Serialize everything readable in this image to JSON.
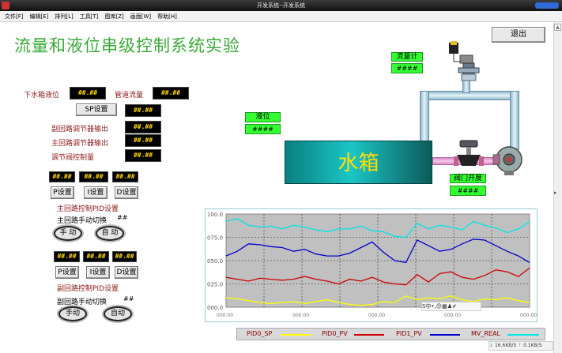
{
  "window": {
    "title": "开发系统--开发系统"
  },
  "menu": [
    "文件[F]",
    "编辑[E]",
    "排列[L]",
    "工具[T]",
    "图库[Z]",
    "画面[W]",
    "帮助[H]"
  ],
  "main_title": "流量和液位串级控制系统实验",
  "exit_button": "退出",
  "top_labels": {
    "lower_tank_level": "下水箱液位",
    "pipe_flow": "管道流量"
  },
  "placeholder_value": "##.##",
  "hash_value": "####",
  "double_hash": "##",
  "sp_button": "SP设置",
  "outputs": {
    "secondary_out": "副回路调节器输出",
    "primary_out": "主回路调节器输出",
    "valve_amount": "调节阀控制量"
  },
  "pid_buttons": {
    "p": "P设置",
    "i": "I设置",
    "d": "D设置"
  },
  "primary_pid_label": "主回路控制PID设置",
  "primary_switch_label": "主回路手动切换",
  "secondary_pid_label": "副回路控制PID设置",
  "secondary_switch_label": "副回路手动切换",
  "mode_buttons": {
    "manual": "手 动",
    "auto": "自 动",
    "manual2": "手动",
    "auto2": "自动"
  },
  "process": {
    "flowmeter_label": "流量计",
    "level_label": "液位",
    "tank_label": "水箱",
    "valve_label": "阀门开度"
  },
  "colors": {
    "title_green": "#3aa83a",
    "display_yellow": "#ffd700",
    "label_green": "#33ff33",
    "sp_series": "#ffff00",
    "pv0_series": "#cc0000",
    "pv1_series": "#0000cc",
    "mv_series": "#00e5e5"
  },
  "chart_data": {
    "type": "line",
    "yticks": [
      "100.0",
      "075.0",
      "050.0",
      "025.0",
      "000.0"
    ],
    "xticks": [
      "000:00",
      "000:00",
      "000:00",
      "000:00",
      "000:00"
    ],
    "ylim": [
      0,
      100
    ],
    "grid": true,
    "legend_position": "bottom",
    "series": [
      {
        "name": "PID0_SP",
        "color": "#ffff00",
        "values": [
          10,
          9,
          7,
          5,
          4,
          5,
          6,
          4,
          6,
          8,
          5,
          3,
          2,
          3,
          6,
          5,
          12,
          8,
          10,
          9,
          12,
          8,
          6,
          9,
          8,
          10,
          7,
          5
        ]
      },
      {
        "name": "PID0_PV",
        "color": "#cc0000",
        "values": [
          32,
          30,
          28,
          31,
          30,
          29,
          30,
          33,
          30,
          28,
          25,
          30,
          28,
          32,
          27,
          25,
          24,
          35,
          27,
          36,
          38,
          32,
          30,
          34,
          40,
          38,
          33,
          42
        ]
      },
      {
        "name": "PID1_PV",
        "color": "#0000cc",
        "values": [
          55,
          60,
          68,
          67,
          65,
          64,
          60,
          62,
          57,
          55,
          55,
          58,
          64,
          70,
          59,
          50,
          48,
          72,
          66,
          60,
          62,
          68,
          73,
          72,
          66,
          60,
          55,
          48
        ]
      },
      {
        "name": "MV_REAL",
        "color": "#00e5e5",
        "values": [
          92,
          95,
          88,
          86,
          87,
          84,
          88,
          86,
          83,
          81,
          84,
          84,
          87,
          82,
          81,
          76,
          75,
          90,
          84,
          88,
          86,
          83,
          92,
          88,
          85,
          80,
          84,
          92
        ]
      }
    ]
  },
  "ime": {
    "text": "S中•,😊▦♟✔"
  },
  "net_status": {
    "down": "16.6KB/S",
    "up": "0.1KB/S"
  }
}
